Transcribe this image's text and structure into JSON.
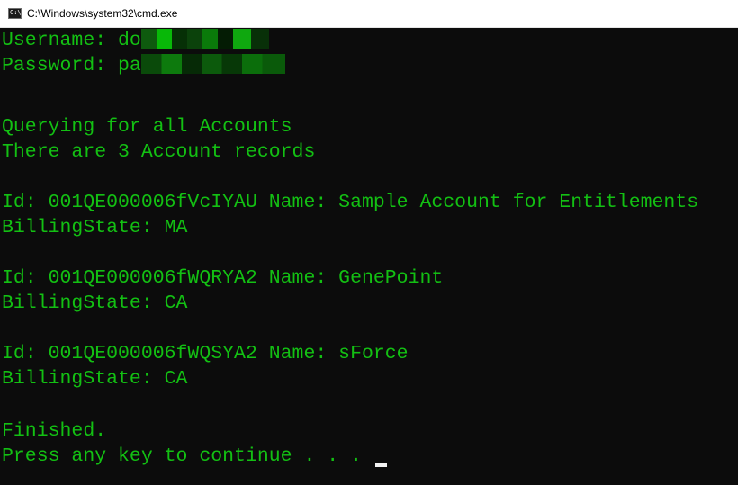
{
  "window": {
    "title": "C:\\Windows\\system32\\cmd.exe",
    "icon": "cmd-icon"
  },
  "console": {
    "text_color": "#13c013",
    "background": "#0c0c0c",
    "lines": [
      "Username: do",
      "Password: pa",
      "",
      "Querying for all Accounts",
      "There are 3 Account records",
      "",
      "Id: 001QE000006fVcIYAU Name: Sample Account for Entitlements",
      "BillingState: MA",
      "",
      "Id: 001QE000006fWQRYA2 Name: GenePoint",
      "BillingState: CA",
      "",
      "Id: 001QE000006fWQSYA2 Name: sForce",
      "BillingState: CA",
      "",
      "Finished.",
      "Press any key to continue . . . "
    ]
  }
}
